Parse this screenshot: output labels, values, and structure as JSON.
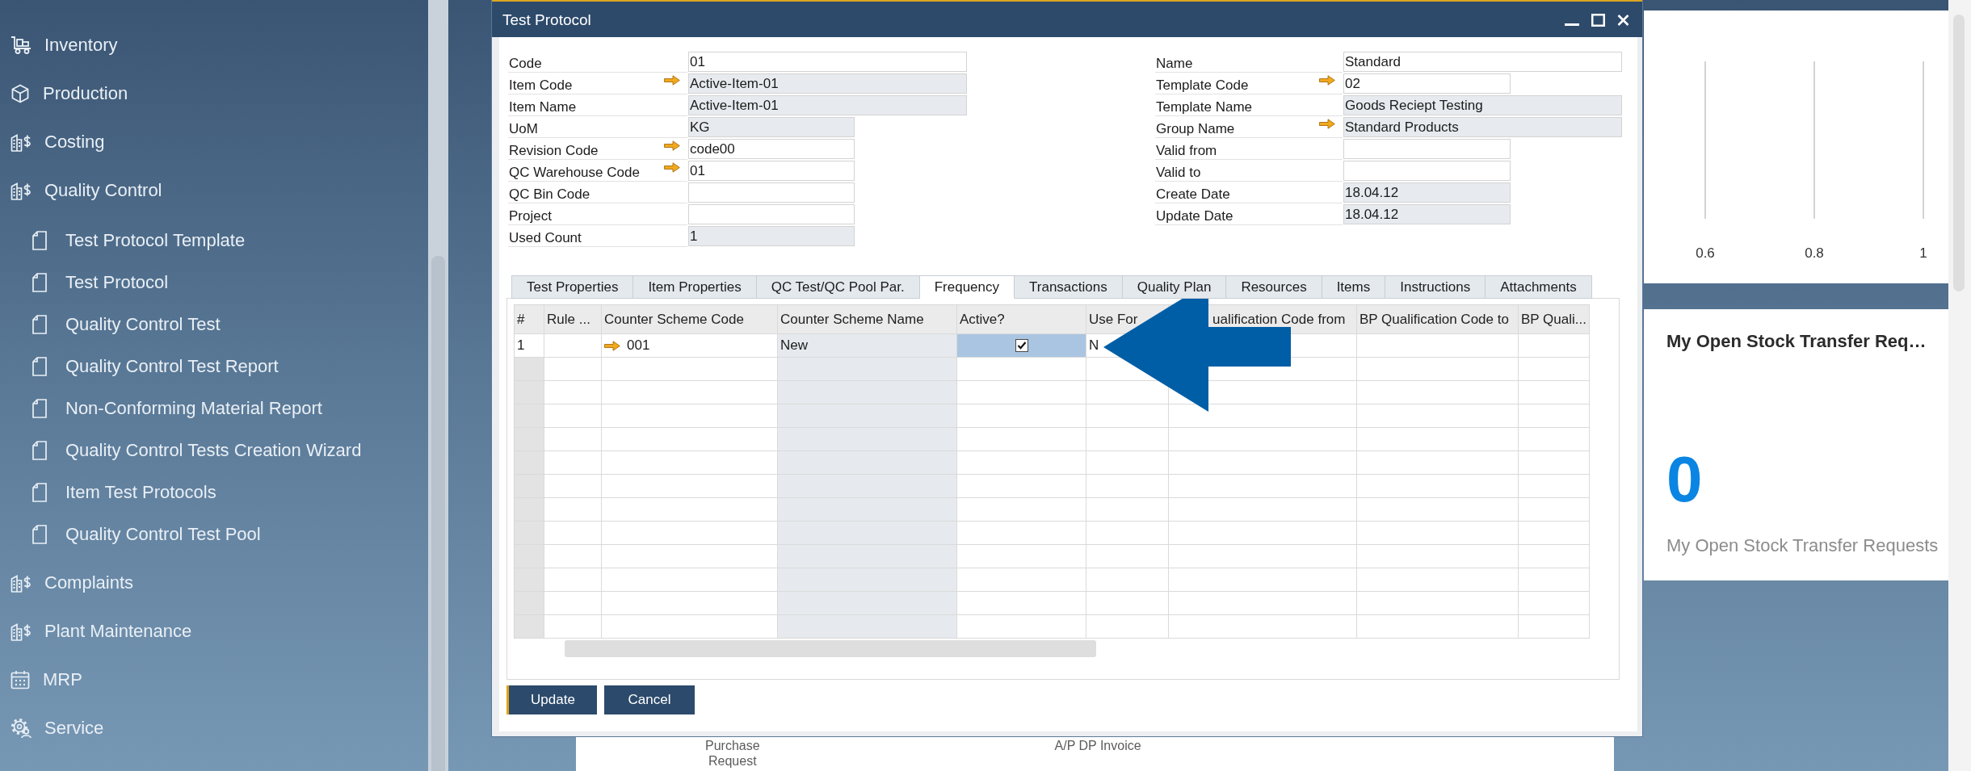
{
  "sidebar": {
    "items": [
      {
        "label": "Inventory"
      },
      {
        "label": "Production"
      },
      {
        "label": "Costing"
      },
      {
        "label": "Quality Control",
        "children": [
          {
            "label": "Test Protocol Template"
          },
          {
            "label": "Test Protocol"
          },
          {
            "label": "Quality Control Test"
          },
          {
            "label": "Quality Control Test Report"
          },
          {
            "label": "Non-Conforming Material Report"
          },
          {
            "label": "Quality Control Tests Creation Wizard"
          },
          {
            "label": "Item Test Protocols"
          },
          {
            "label": "Quality Control Test Pool"
          }
        ]
      },
      {
        "label": "Complaints"
      },
      {
        "label": "Plant Maintenance"
      },
      {
        "label": "MRP"
      },
      {
        "label": "Service"
      }
    ]
  },
  "dialog": {
    "title": "Test Protocol",
    "fields_left": [
      {
        "label": "Code",
        "value": "01",
        "link": false,
        "read_only": false
      },
      {
        "label": "Item Code",
        "value": "Active-Item-01",
        "link": true,
        "read_only": true
      },
      {
        "label": "Item Name",
        "value": "Active-Item-01",
        "link": false,
        "read_only": true
      },
      {
        "label": "UoM",
        "value": "KG",
        "link": false,
        "read_only": true
      },
      {
        "label": "Revision Code",
        "value": "code00",
        "link": true,
        "read_only": false
      },
      {
        "label": "QC Warehouse Code",
        "value": "01",
        "link": true,
        "read_only": false
      },
      {
        "label": "QC Bin Code",
        "link": false,
        "read_only": false
      },
      {
        "label": "Project",
        "link": false,
        "read_only": false
      },
      {
        "label": "Used Count",
        "value": "1",
        "link": false,
        "read_only": true
      }
    ],
    "fields_right": [
      {
        "label": "Name",
        "value": "Standard",
        "link": false,
        "read_only": false
      },
      {
        "label": "Template Code",
        "value": "02",
        "link": true,
        "read_only": false
      },
      {
        "label": "Template Name",
        "value": "Goods Reciept Testing",
        "link": false,
        "read_only": true
      },
      {
        "label": "Group Name",
        "value": "Standard Products",
        "link": true,
        "read_only": true
      },
      {
        "label": "Valid from",
        "link": false,
        "read_only": false
      },
      {
        "label": "Valid to",
        "link": false,
        "read_only": false
      },
      {
        "label": "Create Date",
        "value": "18.04.12",
        "link": false,
        "read_only": true
      },
      {
        "label": "Update Date",
        "value": "18.04.12",
        "link": false,
        "read_only": true
      }
    ],
    "tabs": [
      {
        "label": "Test Properties",
        "selected": false
      },
      {
        "label": "Item Properties",
        "selected": false
      },
      {
        "label": "QC Test/QC Pool Par.",
        "selected": false
      },
      {
        "label": "Frequency",
        "selected": true
      },
      {
        "label": "Transactions",
        "selected": false
      },
      {
        "label": "Quality Plan",
        "selected": false
      },
      {
        "label": "Resources",
        "selected": false
      },
      {
        "label": "Items",
        "selected": false
      },
      {
        "label": "Instructions",
        "selected": false
      },
      {
        "label": "Attachments",
        "selected": false
      }
    ],
    "grid": {
      "columns": [
        {
          "label": "#",
          "read_only": false
        },
        {
          "label": "Rule ...",
          "read_only": false
        },
        {
          "label": "Counter Scheme Code",
          "read_only": false
        },
        {
          "label": "Counter Scheme Name",
          "read_only": true
        },
        {
          "label": "Active?",
          "read_only": false
        },
        {
          "label": "Use For",
          "read_only": false
        },
        {
          "label": "ualification Code from",
          "read_only": false
        },
        {
          "label": "BP Qualification Code to",
          "read_only": false
        },
        {
          "label": "BP Quali...",
          "read_only": false
        }
      ],
      "rows": [
        {
          "cells": [
            {
              "kind": "text",
              "text": "1",
              "link": false,
              "selected": false
            },
            {
              "kind": "text",
              "link": false,
              "selected": false
            },
            {
              "kind": "text",
              "text": "001",
              "link": true,
              "selected": false
            },
            {
              "kind": "text",
              "text": "New",
              "link": false,
              "selected": false
            },
            {
              "kind": "checkbox",
              "checked": true,
              "selected": true
            },
            {
              "kind": "text",
              "text": "N",
              "link": false,
              "selected": false
            },
            {
              "kind": "text",
              "link": false,
              "selected": false
            },
            {
              "kind": "text",
              "link": false,
              "selected": false
            },
            {
              "kind": "text",
              "link": false,
              "selected": false
            }
          ]
        }
      ]
    },
    "buttons": [
      {
        "label": "Update",
        "default": true
      },
      {
        "label": "Cancel",
        "default": false
      }
    ]
  },
  "tiles": [
    {
      "label": "Purchase Request"
    },
    {
      "label": "A/P DP Invoice"
    }
  ],
  "widgets": [
    {
      "kind": "chart",
      "tick_labels": [
        "0.6",
        "0.8",
        "1"
      ]
    },
    {
      "kind": "kpi",
      "title": "My Open Stock Transfer Req…",
      "count": "0",
      "caption": "My Open Stock Transfer Requests"
    }
  ]
}
